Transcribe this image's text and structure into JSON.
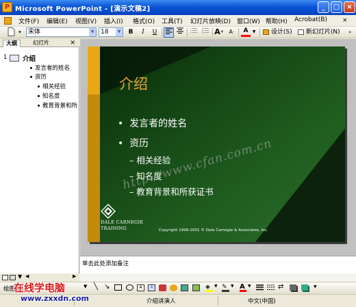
{
  "window": {
    "title": "Microsoft PowerPoint - [演示文稿2]",
    "minimize": "_",
    "maximize": "□",
    "close": "×"
  },
  "menubar": {
    "items": [
      "文件(F)",
      "编辑(E)",
      "视图(V)",
      "插入(I)",
      "格式(O)",
      "工具(T)",
      "幻灯片放映(D)",
      "窗口(W)",
      "帮助(H)",
      "Acrobat(B)"
    ]
  },
  "toolbar": {
    "font_name": "宋体",
    "font_size": "18",
    "bold": "B",
    "italic": "I",
    "underline": "U",
    "font_color": "A",
    "design": "设计(S)",
    "new_slide": "新幻灯片(N)"
  },
  "left_panel": {
    "tabs": [
      "大纲",
      "幻灯片"
    ],
    "close": "×",
    "slide_number": "1",
    "outline_title": "介绍",
    "outline": [
      "发言者的姓名",
      "资历"
    ],
    "outline_sub": [
      "相关经验",
      "知名度",
      "教育背景和所"
    ]
  },
  "slide": {
    "title": "介绍",
    "bullets": [
      "发言者的姓名",
      "资历"
    ],
    "sub_bullets": [
      "相关经验",
      "知名度",
      "教育背景和所获证书"
    ],
    "logo_line1": "Dale Carnegie",
    "logo_line2": "Training",
    "copyright": "Copyright 1999-2001 © Dale Carnegie & Associates, Inc.",
    "colors": {
      "background": "#0A1F0A",
      "panel": "#1E5A1E",
      "title": "#E8A23A",
      "accent_bar": "#E8A816",
      "text": "#FFFFFF"
    }
  },
  "notes": {
    "placeholder": "单击此处添加备注"
  },
  "watermark": {
    "diagonal": "http://www.cfan.com.cn",
    "site_name": "在线学电脑",
    "site_url": "www.zxxdn.com"
  },
  "drawbar": {
    "draw": "绘图(R)"
  },
  "statusbar": {
    "design": "介绍讲演人",
    "language": "中文(中国)"
  }
}
